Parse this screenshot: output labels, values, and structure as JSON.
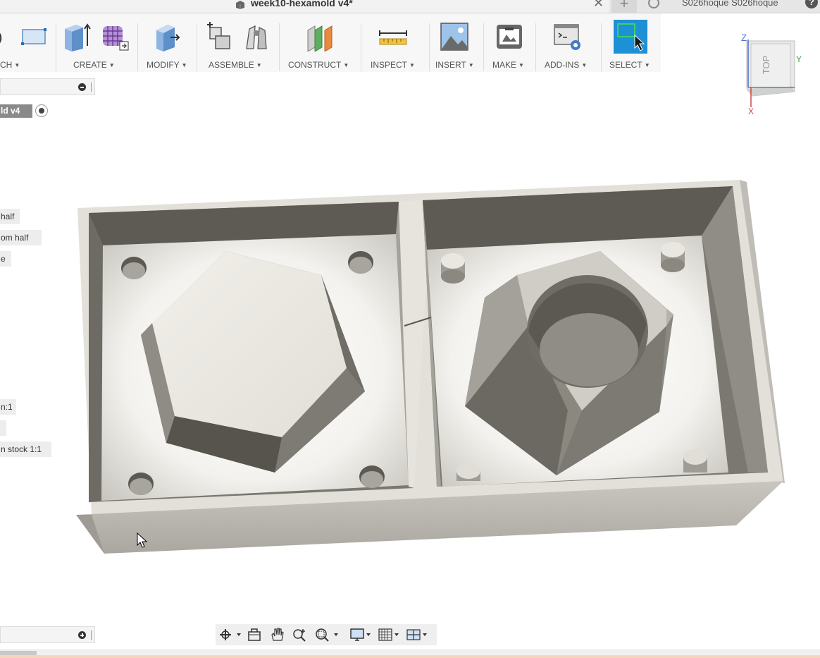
{
  "window": {
    "doc_title": "week10-hexamold v4*",
    "user_name": "S026hoque S026hoque",
    "help_label": "?"
  },
  "toolbar": {
    "groups": [
      {
        "label": "CH",
        "icons": [
          "sketch-arc-icon",
          "sketch-rectangle-icon"
        ]
      },
      {
        "label": "CREATE",
        "icons": [
          "extrude-box-icon",
          "form-grid-icon"
        ]
      },
      {
        "label": "MODIFY",
        "icons": [
          "press-pull-icon"
        ]
      },
      {
        "label": "ASSEMBLE",
        "icons": [
          "new-component-icon",
          "joint-icon"
        ]
      },
      {
        "label": "CONSTRUCT",
        "icons": [
          "offset-plane-icon"
        ]
      },
      {
        "label": "INSPECT",
        "icons": [
          "measure-ruler-icon"
        ]
      },
      {
        "label": "INSERT",
        "icons": [
          "insert-image-icon"
        ]
      },
      {
        "label": "MAKE",
        "icons": [
          "print-3d-icon"
        ]
      },
      {
        "label": "ADD-INS",
        "icons": [
          "scripts-addins-icon"
        ]
      },
      {
        "label": "SELECT",
        "icons": [
          "select-window-icon"
        ]
      }
    ]
  },
  "browser": {
    "document_node": "ld v4",
    "items": [
      "half",
      "om half",
      "e",
      "n:1",
      "",
      "n stock 1:1"
    ]
  },
  "viewcube": {
    "face_label": "TOP",
    "axis_x": "X",
    "axis_y": "Y",
    "axis_z": "Z"
  },
  "navbar": {
    "items": [
      "orbit-icon",
      "look-at-icon",
      "pan-icon",
      "zoom-icon",
      "fit-icon",
      "display-settings-icon",
      "grid-icon",
      "viewports-icon"
    ]
  },
  "colors": {
    "toolbar_bg": "#f7f7f7",
    "select_active": "#1e90d6",
    "model_gray": "#c8c6bf"
  }
}
